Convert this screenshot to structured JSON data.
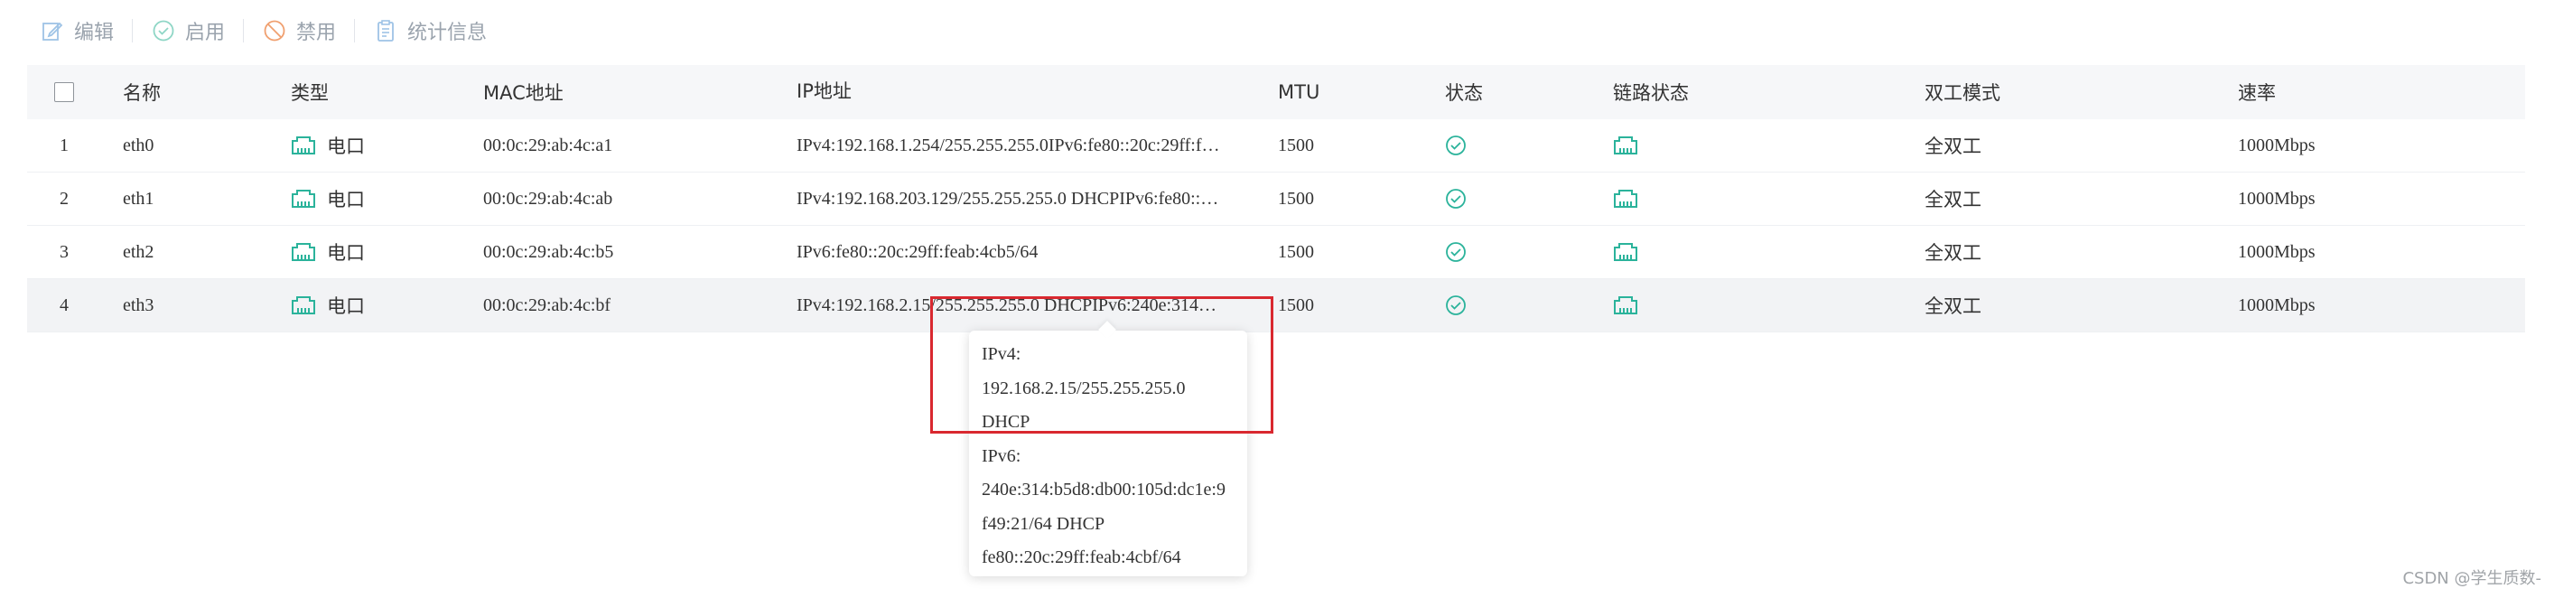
{
  "toolbar": {
    "edit_label": "编辑",
    "enable_label": "启用",
    "disable_label": "禁用",
    "stats_label": "统计信息"
  },
  "table": {
    "headers": {
      "name": "名称",
      "type": "类型",
      "mac": "MAC地址",
      "ip": "IP地址",
      "mtu": "MTU",
      "state": "状态",
      "link_state": "链路状态",
      "duplex": "双工模式",
      "rate": "速率"
    },
    "rows": [
      {
        "index": "1",
        "name": "eth0",
        "type": "电口",
        "mac": "00:0c:29:ab:4c:a1",
        "ip": "IPv4:192.168.1.254/255.255.255.0IPv6:fe80::20c:29ff:f…",
        "mtu": "1500",
        "duplex": "全双工",
        "rate": "1000Mbps"
      },
      {
        "index": "2",
        "name": "eth1",
        "type": "电口",
        "mac": "00:0c:29:ab:4c:ab",
        "ip": "IPv4:192.168.203.129/255.255.255.0 DHCPIPv6:fe80::…",
        "mtu": "1500",
        "duplex": "全双工",
        "rate": "1000Mbps"
      },
      {
        "index": "3",
        "name": "eth2",
        "type": "电口",
        "mac": "00:0c:29:ab:4c:b5",
        "ip": "IPv6:fe80::20c:29ff:feab:4cb5/64",
        "mtu": "1500",
        "duplex": "全双工",
        "rate": "1000Mbps"
      },
      {
        "index": "4",
        "name": "eth3",
        "type": "电口",
        "mac": "00:0c:29:ab:4c:bf",
        "ip": "IPv4:192.168.2.15/255.255.255.0 DHCPIPv6:240e:314…",
        "mtu": "1500",
        "duplex": "全双工",
        "rate": "1000Mbps"
      }
    ]
  },
  "tooltip": {
    "lines": [
      "IPv4:",
      "192.168.2.15/255.255.255.0",
      "DHCP",
      "IPv6:",
      "240e:314:b5d8:db00:105d:dc1e:9",
      "f49:21/64 DHCP",
      "fe80::20c:29ff:feab:4cbf/64"
    ]
  },
  "watermark": "CSDN @学生质数-",
  "colors": {
    "accent_teal": "#2bb39b",
    "toolbar_icon": "#9aa3ad",
    "highlight_red": "#d9282f",
    "disable_orange": "#f0a070"
  }
}
